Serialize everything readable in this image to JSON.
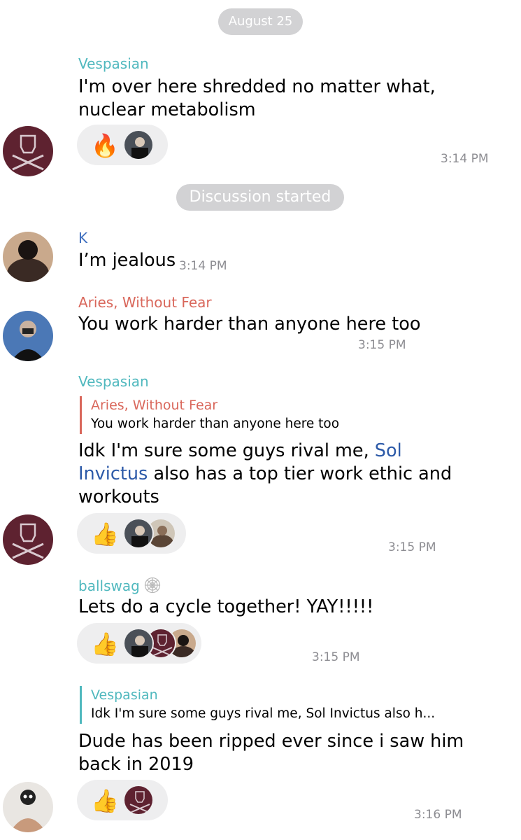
{
  "date_pill": "August 25",
  "discussion_pill": "Discussion started",
  "messages": [
    {
      "sender": "Vespasian",
      "text": "I'm over here shredded no matter what, nuclear metabolism",
      "time": "3:14 PM",
      "reaction_emoji": "🔥"
    },
    {
      "sender": "K",
      "text": "I’m jealous",
      "time": "3:14 PM"
    },
    {
      "sender": "Aries, Without Fear",
      "text": "You work harder than anyone here too",
      "time": "3:15 PM"
    },
    {
      "sender": "Vespasian",
      "reply_to": {
        "sender": "Aries, Without Fear",
        "text": "You work harder than anyone here too"
      },
      "text_before": "Idk I'm sure some guys rival me,",
      "mention": "Sol Invictus",
      "text_after": "also has a top tier work ethic and workouts",
      "time": "3:15 PM",
      "reaction_emoji": "👍"
    },
    {
      "sender": "ballswag",
      "text": "Lets do a cycle together! YAY!!!!!",
      "time": "3:15 PM",
      "reaction_emoji": "👍"
    },
    {
      "reply_to": {
        "sender": "Vespasian",
        "text": "Idk I'm sure some guys rival me, Sol Invictus also h..."
      },
      "text": "Dude has been ripped ever since i saw him back in 2019",
      "time": "3:16 PM",
      "reaction_emoji": "👍"
    }
  ],
  "colors": {
    "vespasian": "#4fb8be",
    "k": "#3f6fbf",
    "aries": "#d9675b",
    "pill_bg": "#d2d2d4",
    "reaction_bg": "#eeeeef"
  }
}
